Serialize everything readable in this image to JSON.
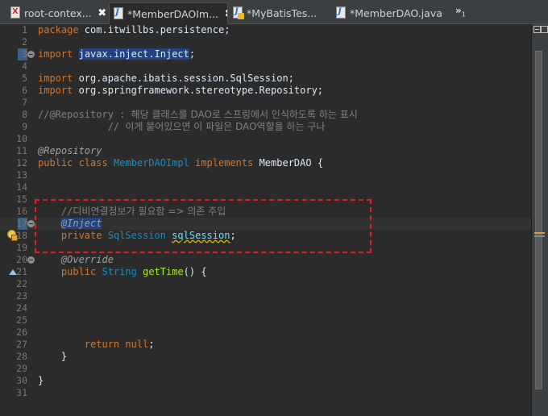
{
  "tabs": [
    {
      "label": "root-contex...",
      "icon": "xml-file-icon",
      "close": "✖",
      "active": false
    },
    {
      "label": "*MemberDAOIm...",
      "icon": "java-file-icon",
      "close": "✖",
      "active": true
    },
    {
      "label": "*MyBatisTes...",
      "icon": "java-file-warning-icon",
      "close": "",
      "active": false
    },
    {
      "label": "*MemberDAO.java",
      "icon": "java-file-icon",
      "close": "",
      "active": false
    }
  ],
  "overflow": {
    "label": "»",
    "count": "1"
  },
  "lines": [
    {
      "n": "1",
      "parts": [
        [
          "kw",
          "package"
        ],
        [
          "pk",
          " com.itwillbs.persistence;"
        ]
      ]
    },
    {
      "n": "2",
      "parts": []
    },
    {
      "n": "3",
      "parts": [
        [
          "kw",
          "import"
        ],
        [
          "pk",
          " "
        ],
        [
          "sel",
          "javax.inject.Inject"
        ],
        [
          "pk",
          ";"
        ]
      ]
    },
    {
      "n": "4",
      "parts": []
    },
    {
      "n": "5",
      "parts": [
        [
          "kw",
          "import"
        ],
        [
          "pk",
          " org.apache.ibatis.session.SqlSession;"
        ]
      ]
    },
    {
      "n": "6",
      "parts": [
        [
          "kw",
          "import"
        ],
        [
          "pk",
          " org.springframework.stereotype.Repository;"
        ]
      ]
    },
    {
      "n": "7",
      "parts": []
    },
    {
      "n": "8",
      "parts": [
        [
          "cm",
          "//@Repository : "
        ],
        [
          "cm-ko",
          "해당 클래스를 DAO로 스프링에서 인식하도록 하는 표시"
        ]
      ]
    },
    {
      "n": "9",
      "parts": [
        [
          "cm",
          "            // "
        ],
        [
          "cm-ko",
          "이게 붙어있으면 이 파일은 DAO역할을 하는 구나"
        ]
      ]
    },
    {
      "n": "10",
      "parts": []
    },
    {
      "n": "11",
      "parts": [
        [
          "an",
          "@Repository"
        ]
      ]
    },
    {
      "n": "12",
      "parts": [
        [
          "kw",
          "public"
        ],
        [
          "pk",
          " "
        ],
        [
          "kw",
          "class"
        ],
        [
          "pk",
          " "
        ],
        [
          "ty",
          "MemberDAOImpl"
        ],
        [
          "pk",
          " "
        ],
        [
          "kw",
          "implements"
        ],
        [
          "pk",
          " MemberDAO {"
        ]
      ]
    },
    {
      "n": "13",
      "parts": []
    },
    {
      "n": "14",
      "parts": []
    },
    {
      "n": "15",
      "parts": []
    },
    {
      "n": "16",
      "parts": [
        [
          "cm",
          "    //"
        ],
        [
          "cm-ko",
          "디비연결정보가 필요함 => 의존 주입"
        ]
      ]
    },
    {
      "n": "17",
      "parts": [
        [
          "pk",
          "    "
        ],
        [
          "sel-an",
          "@Inject"
        ]
      ]
    },
    {
      "n": "18",
      "parts": [
        [
          "pk",
          "    "
        ],
        [
          "kw",
          "private"
        ],
        [
          "pk",
          " "
        ],
        [
          "ty",
          "SqlSession"
        ],
        [
          "pk",
          " "
        ],
        [
          "fd-sq",
          "sqlSession"
        ],
        [
          "pk",
          ";"
        ]
      ]
    },
    {
      "n": "19",
      "parts": []
    },
    {
      "n": "20",
      "parts": [
        [
          "pk",
          "    "
        ],
        [
          "an",
          "@Override"
        ]
      ]
    },
    {
      "n": "21",
      "parts": [
        [
          "pk",
          "    "
        ],
        [
          "kw",
          "public"
        ],
        [
          "pk",
          " "
        ],
        [
          "ty",
          "String"
        ],
        [
          "pk",
          " "
        ],
        [
          "me",
          "getTime"
        ],
        [
          "pk",
          "() {"
        ]
      ]
    },
    {
      "n": "22",
      "parts": []
    },
    {
      "n": "23",
      "parts": []
    },
    {
      "n": "24",
      "parts": []
    },
    {
      "n": "25",
      "parts": []
    },
    {
      "n": "26",
      "parts": []
    },
    {
      "n": "27",
      "parts": [
        [
          "pk",
          "        "
        ],
        [
          "kw",
          "return"
        ],
        [
          "pk",
          " "
        ],
        [
          "kw",
          "null"
        ],
        [
          "pk",
          ";"
        ]
      ]
    },
    {
      "n": "28",
      "parts": [
        [
          "pk",
          "    }"
        ]
      ]
    },
    {
      "n": "29",
      "parts": []
    },
    {
      "n": "30",
      "parts": [
        [
          "pk",
          "}"
        ]
      ]
    },
    {
      "n": "31",
      "parts": []
    }
  ],
  "colors": {
    "annotation_box": "#e02020",
    "selection": "#214283",
    "keyword": "#cc7832"
  }
}
